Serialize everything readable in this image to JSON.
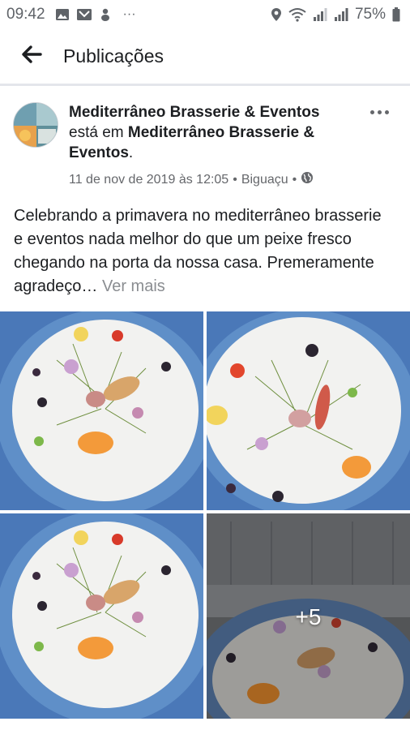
{
  "status_bar": {
    "time": "09:42",
    "left_icons": [
      "image-icon",
      "gallery-icon",
      "cat-icon",
      "more-dots-icon"
    ],
    "overflow": "···",
    "right_icons": [
      "location-icon",
      "wifi-icon",
      "signal-icon",
      "signal-icon"
    ],
    "battery": "75%"
  },
  "header": {
    "title": "Publicações",
    "back_icon": "arrow-left-icon"
  },
  "post": {
    "author": "Mediterrâneo Brasserie & Eventos",
    "at_text": "está em",
    "place": "Mediterrâneo Brasserie & Eventos",
    "date": "11 de nov de 2019 às 12:05",
    "separator": "•",
    "location": "Biguaçu",
    "privacy_icon": "globe-icon",
    "text": "Celebrando a primavera no mediterrâneo brasserie e eventos  nada melhor do que um peixe  fresco chegando na porta da nossa casa. Premeramente agradeço…",
    "see_more": "Ver mais",
    "more_photos": "+5"
  },
  "colors": {
    "plate_rim": "#3e70b0",
    "plate": "#f2f2f0",
    "text_secondary": "#65676b"
  }
}
